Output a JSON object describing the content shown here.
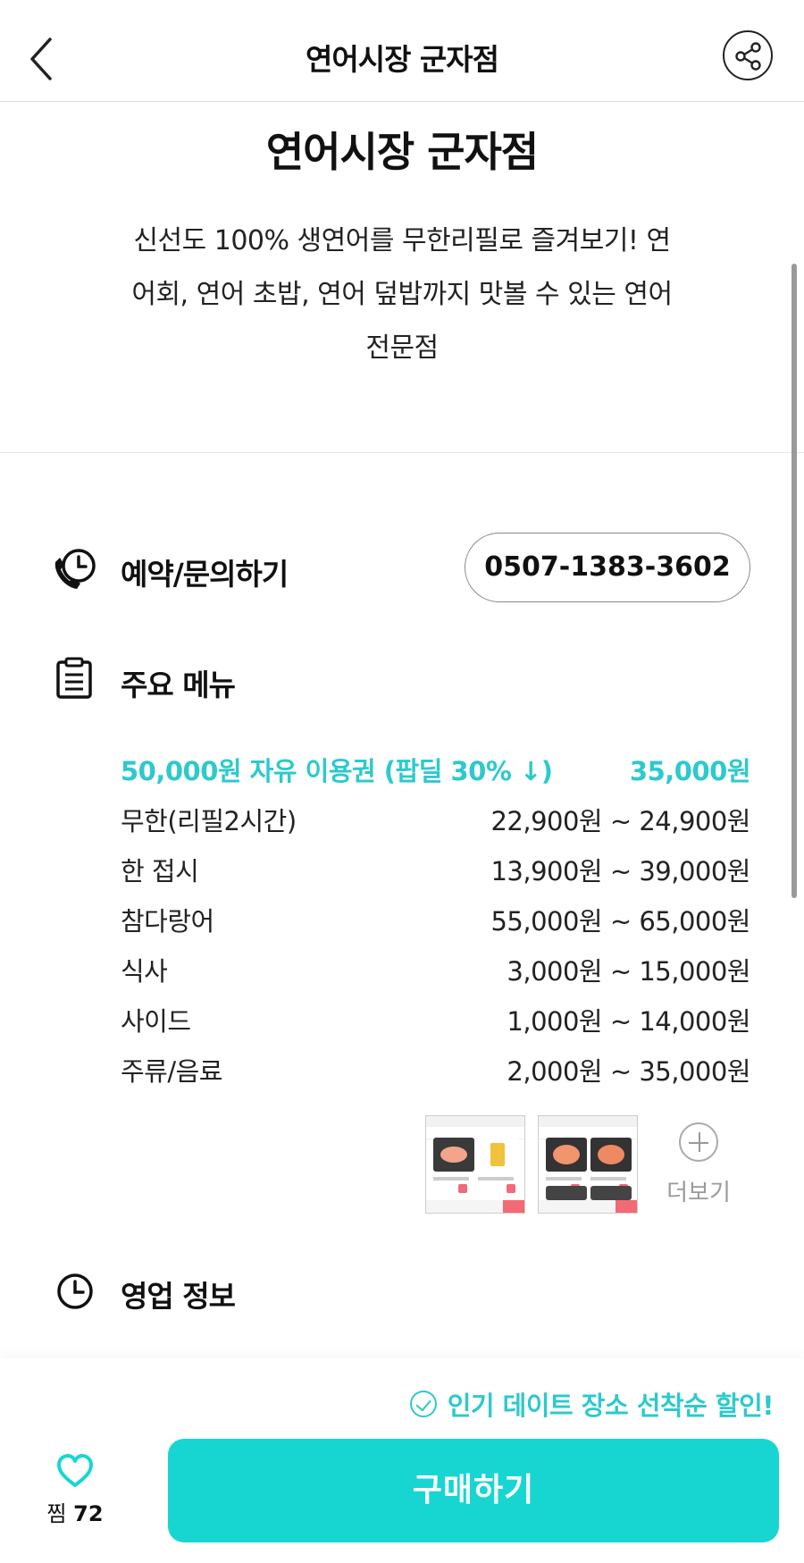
{
  "header": {
    "title": "연어시장 군자점"
  },
  "place": {
    "name": "연어시장 군자점",
    "description_lines": [
      "신선도 100% 생연어를 무한리필로 즐겨보기! 연",
      "어회, 연어 초밥, 연어 덮밥까지 맛볼 수 있는 연어",
      "전문점"
    ]
  },
  "reservation": {
    "label": "예약/문의하기",
    "phone": "0507-1383-3602"
  },
  "menu": {
    "title": "주요 메뉴",
    "items": [
      {
        "name": "50,000원 자유 이용권 (팝딜 30% ↓)",
        "price": "35,000원",
        "highlight": true
      },
      {
        "name": "무한(리필2시간)",
        "price": "22,900원 ~ 24,900원"
      },
      {
        "name": "한 접시",
        "price": "13,900원 ~ 39,000원"
      },
      {
        "name": "참다랑어",
        "price": "55,000원 ~ 65,000원"
      },
      {
        "name": "식사",
        "price": "3,000원 ~ 15,000원"
      },
      {
        "name": "사이드",
        "price": "1,000원 ~ 14,000원"
      },
      {
        "name": "주류/음료",
        "price": "2,000원 ~ 35,000원"
      }
    ],
    "more_label": "더보기"
  },
  "hours": {
    "title": "영업 정보"
  },
  "bottom": {
    "promo": "인기 데이트 장소 선착순 할인!",
    "like_label": "찜",
    "like_count": "72",
    "buy_label": "구매하기"
  },
  "colors": {
    "accent": "#2ec9cc",
    "buy_button": "#17d6d2"
  }
}
